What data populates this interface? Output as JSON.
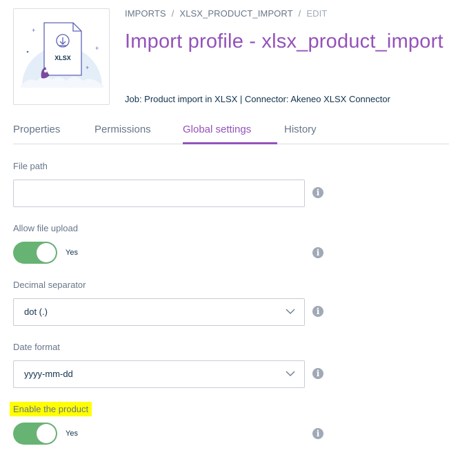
{
  "breadcrumb": {
    "items": [
      "IMPORTS",
      "XLSX_PRODUCT_IMPORT",
      "EDIT"
    ],
    "separator": "/"
  },
  "title": "Import profile - xlsx_product_import",
  "job_info": "Job: Product import in XLSX | Connector: Akeneo XLSX Connector",
  "illustration": {
    "file_label": "XLSX",
    "icon": "download-icon"
  },
  "tabs": [
    {
      "label": "Properties",
      "active": false
    },
    {
      "label": "Permissions",
      "active": false
    },
    {
      "label": "Global settings",
      "active": true
    },
    {
      "label": "History",
      "active": false
    }
  ],
  "fields": {
    "file_path": {
      "label": "File path",
      "value": ""
    },
    "allow_file_upload": {
      "label": "Allow file upload",
      "state": "Yes"
    },
    "decimal_separator": {
      "label": "Decimal separator",
      "value": "dot (.)"
    },
    "date_format": {
      "label": "Date format",
      "value": "yyyy-mm-dd"
    },
    "enable_product": {
      "label": "Enable the product",
      "state": "Yes"
    }
  },
  "info_icon_glyph": "i",
  "colors": {
    "accent": "#9452ba",
    "switch_on": "#67b373",
    "highlight": "#ffff00"
  }
}
